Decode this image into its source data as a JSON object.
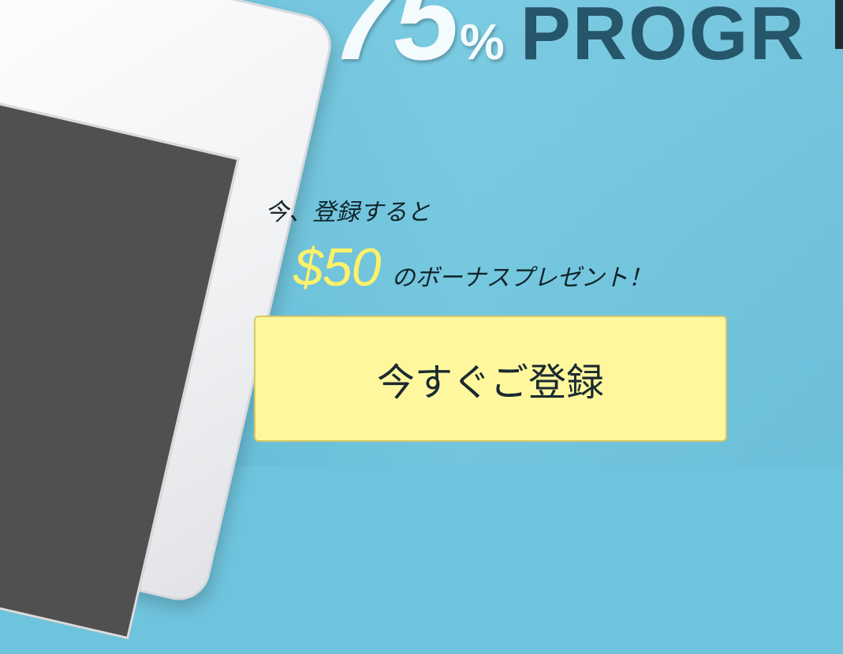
{
  "headline": {
    "number": "75",
    "percent": "%",
    "word": "PROGR"
  },
  "promo": {
    "line1": "今、登録すると",
    "amount": "$50",
    "line2_rest": "のボーナスプレゼント！"
  },
  "cta": {
    "label": "今すぐご登録"
  },
  "colors": {
    "background": "#6fc4dd",
    "headline_number": "#f4fbfd",
    "headline_word": "#26566a",
    "amount": "#fcf16a",
    "button_bg": "#fff79e",
    "button_border": "#d6c865"
  }
}
